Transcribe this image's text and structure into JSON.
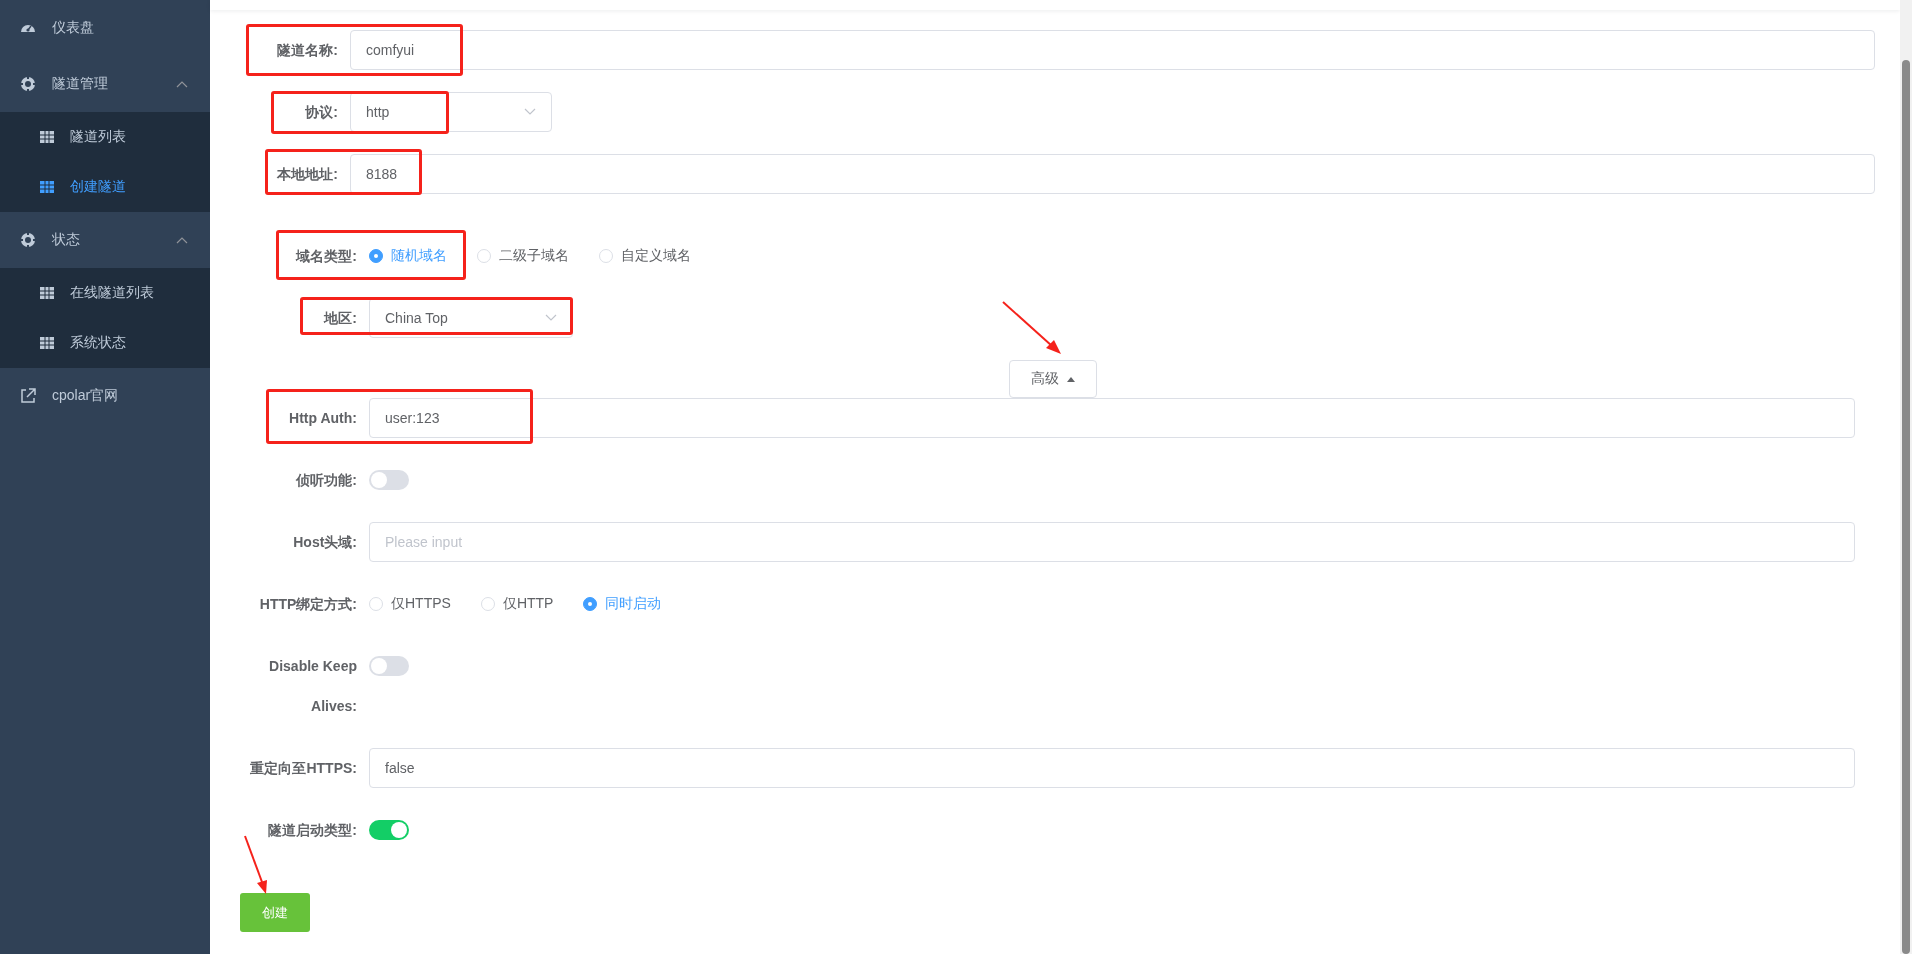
{
  "sidebar": {
    "items": [
      {
        "label": "仪表盘",
        "kind": "link"
      },
      {
        "label": "隧道管理",
        "kind": "group",
        "expanded": true,
        "children": [
          {
            "label": "隧道列表",
            "selected": false
          },
          {
            "label": "创建隧道",
            "selected": true
          }
        ]
      },
      {
        "label": "状态",
        "kind": "group",
        "expanded": true,
        "children": [
          {
            "label": "在线隧道列表",
            "selected": false
          },
          {
            "label": "系统状态",
            "selected": false
          }
        ]
      },
      {
        "label": "cpolar官网",
        "kind": "link"
      }
    ]
  },
  "basic_fields": [
    {
      "label": "隧道名称:",
      "kind": "input",
      "value": "comfyui",
      "highlighted": true
    },
    {
      "label": "协议:",
      "kind": "select",
      "value": "http",
      "highlighted": true
    },
    {
      "label": "本地地址:",
      "kind": "input",
      "value": "8188",
      "highlighted": true
    }
  ],
  "domain_fields": [
    {
      "label": "域名类型:",
      "kind": "radio",
      "options": [
        {
          "label": "随机域名",
          "selected": true
        },
        {
          "label": "二级子域名",
          "selected": false
        },
        {
          "label": "自定义域名",
          "selected": false
        }
      ],
      "highlighted": true
    },
    {
      "label": "地区:",
      "kind": "select",
      "value": "China Top",
      "highlighted": true
    }
  ],
  "advanced_toggle": {
    "label": "高级",
    "expanded": true
  },
  "advanced_fields": [
    {
      "label": "Http Auth:",
      "kind": "input",
      "value": "user:123",
      "highlighted": true
    },
    {
      "label": "侦听功能:",
      "kind": "switch",
      "on": false,
      "highlighted": false
    },
    {
      "label": "Host头域:",
      "kind": "input",
      "placeholder": "Please input",
      "highlighted": false
    },
    {
      "label": "HTTP绑定方式:",
      "kind": "radio",
      "options": [
        {
          "label": "仅HTTPS",
          "selected": false
        },
        {
          "label": "仅HTTP",
          "selected": false
        },
        {
          "label": "同时启动",
          "selected": true
        }
      ],
      "highlighted": false
    },
    {
      "label": "Disable Keep Alives:",
      "kind": "switch",
      "on": false,
      "highlighted": false
    },
    {
      "label": "重定向至HTTPS:",
      "kind": "input",
      "value": "false",
      "highlighted": false
    },
    {
      "label": "隧道启动类型:",
      "kind": "switch",
      "on": true,
      "highlighted": false
    }
  ],
  "submit": {
    "label": "创建"
  }
}
